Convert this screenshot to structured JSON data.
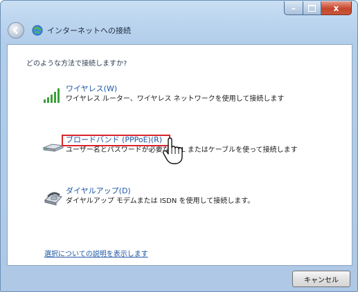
{
  "window": {
    "title": "インターネットへの接続",
    "caption_buttons": {
      "minimize": "–",
      "maximize": "",
      "close": "x"
    }
  },
  "question": "どのような方法で接続しますか?",
  "options": [
    {
      "title": "ワイヤレス(W)",
      "description": "ワイヤレス ルーター、ワイヤレス ネットワークを使用して接続します",
      "icon": "wireless-signal-icon"
    },
    {
      "title": "ブロードバンド (PPPoE)(R)",
      "description": "ユーザー名とパスワードが必要な DSL またはケーブルを使って接続します",
      "icon": "broadband-modem-icon"
    },
    {
      "title": "ダイヤルアップ(D)",
      "description": "ダイヤルアップ モデムまたは ISDN を使用して接続します。",
      "icon": "dialup-modem-icon"
    }
  ],
  "help_link": "選択についての説明を表示します",
  "footer": {
    "cancel_label": "キャンセル"
  },
  "colors": {
    "highlight": "#d9242b",
    "link": "#1b55a4",
    "frame": "#bcd5ef"
  }
}
